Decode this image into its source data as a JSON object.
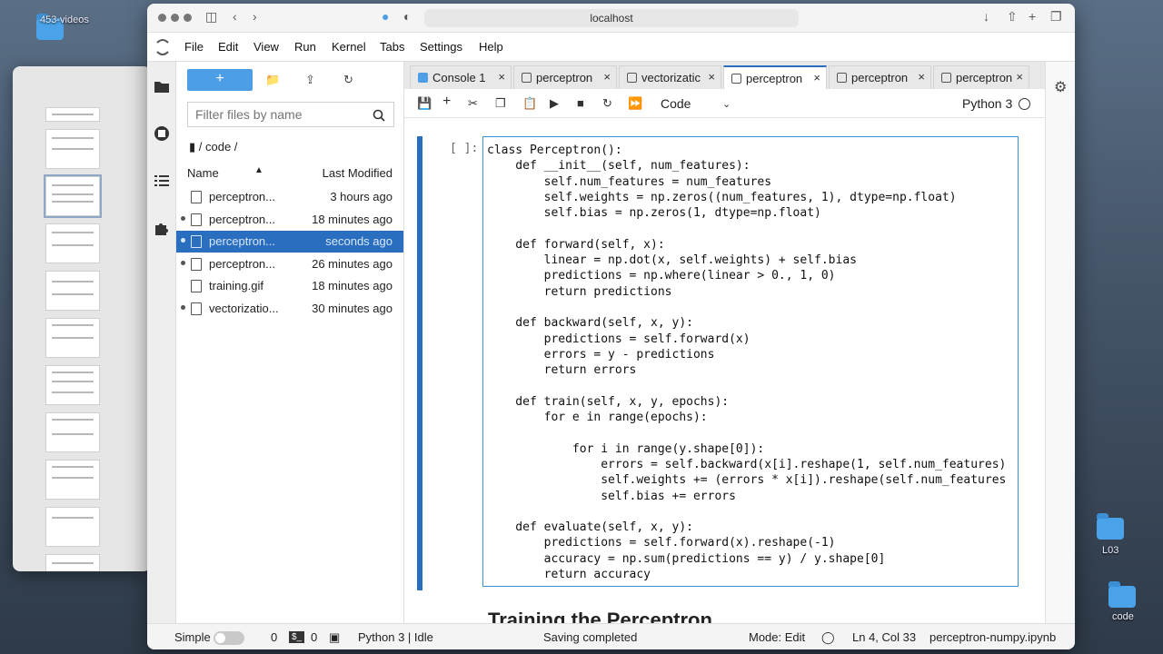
{
  "desktop": {
    "top_folder_label": "453-videos",
    "folder_l03": "L03",
    "folder_code": "code"
  },
  "browser": {
    "url": "localhost"
  },
  "menu": [
    "File",
    "Edit",
    "View",
    "Run",
    "Kernel",
    "Tabs",
    "Settings",
    "Help"
  ],
  "filebrowser": {
    "new_label": "+",
    "filter_placeholder": "Filter files by name",
    "breadcrumb": "/ code /",
    "col_name": "Name",
    "col_modified": "Last Modified",
    "files": [
      {
        "name": "perceptron...",
        "modified": "3 hours ago",
        "running": false,
        "selected": false,
        "kind": "file"
      },
      {
        "name": "perceptron...",
        "modified": "18 minutes ago",
        "running": true,
        "selected": false,
        "kind": "notebook"
      },
      {
        "name": "perceptron...",
        "modified": "seconds ago",
        "running": true,
        "selected": true,
        "kind": "notebook"
      },
      {
        "name": "perceptron...",
        "modified": "26 minutes ago",
        "running": true,
        "selected": false,
        "kind": "notebook"
      },
      {
        "name": "training.gif",
        "modified": "18 minutes ago",
        "running": false,
        "selected": false,
        "kind": "image"
      },
      {
        "name": "vectorizatio...",
        "modified": "30 minutes ago",
        "running": true,
        "selected": false,
        "kind": "notebook"
      }
    ]
  },
  "tabs": [
    {
      "label": "Console 1",
      "active": false
    },
    {
      "label": "perceptron",
      "active": false
    },
    {
      "label": "vectorizatic",
      "active": false
    },
    {
      "label": "perceptron",
      "active": true
    },
    {
      "label": "perceptron",
      "active": false
    },
    {
      "label": "perceptron",
      "active": false
    }
  ],
  "notebook_toolbar": {
    "cell_type": "Code",
    "kernel": "Python 3"
  },
  "cell": {
    "prompt": "[ ]:",
    "code_lines": [
      "class Perceptron():",
      "    def __init__(self, num_features):",
      "        self.num_features = num_features",
      "        self.weights = np.zeros((num_features, 1), dtype=np.float)",
      "        self.bias = np.zeros(1, dtype=np.float)",
      "",
      "    def forward(self, x):",
      "        linear = np.dot(x, self.weights) + self.bias",
      "        predictions = np.where(linear > 0., 1, 0)",
      "        return predictions",
      "",
      "    def backward(self, x, y):",
      "        predictions = self.forward(x)",
      "        errors = y - predictions",
      "        return errors",
      "",
      "    def train(self, x, y, epochs):",
      "        for e in range(epochs):",
      "",
      "            for i in range(y.shape[0]):",
      "                errors = self.backward(x[i].reshape(1, self.num_features)",
      "                self.weights += (errors * x[i]).reshape(self.num_features",
      "                self.bias += errors",
      "",
      "    def evaluate(self, x, y):",
      "        predictions = self.forward(x).reshape(-1)",
      "        accuracy = np.sum(predictions == y) / y.shape[0]",
      "        return accuracy"
    ]
  },
  "next_heading": "Training the Perceptron",
  "status": {
    "mode_label": "Simple",
    "terminals": "0",
    "kernels": "0",
    "kernel_status": "Python 3 | Idle",
    "save_status": "Saving completed",
    "edit_mode": "Mode: Edit",
    "cursor": "Ln 4, Col 33",
    "filename": "perceptron-numpy.ipynb"
  },
  "colors": {
    "accent": "#2a6fbf",
    "new_button": "#4c9fe6"
  }
}
